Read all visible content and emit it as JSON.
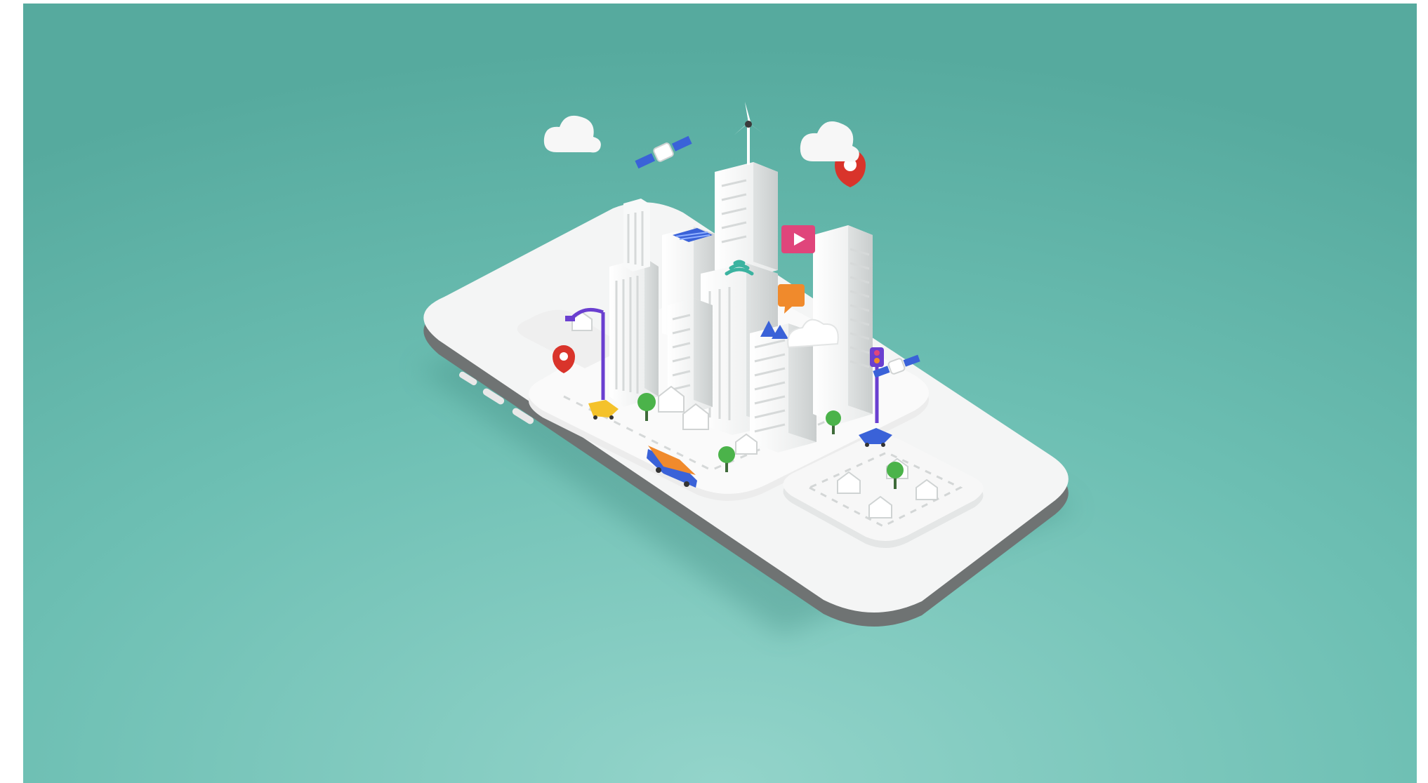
{
  "scene": {
    "background": "#5fb3a7",
    "background_light": "#8ed0c6",
    "surface": "#f5f6f6",
    "accent_red": "#d9342b",
    "accent_purple": "#6a3fd0",
    "accent_pink": "#e0457b",
    "accent_orange": "#f08a2c",
    "accent_blue": "#3a62d8",
    "tree_green": "#4bb34a"
  },
  "objects": {
    "clouds": 3,
    "pins": 2,
    "satellites": 2,
    "cars": 3
  }
}
